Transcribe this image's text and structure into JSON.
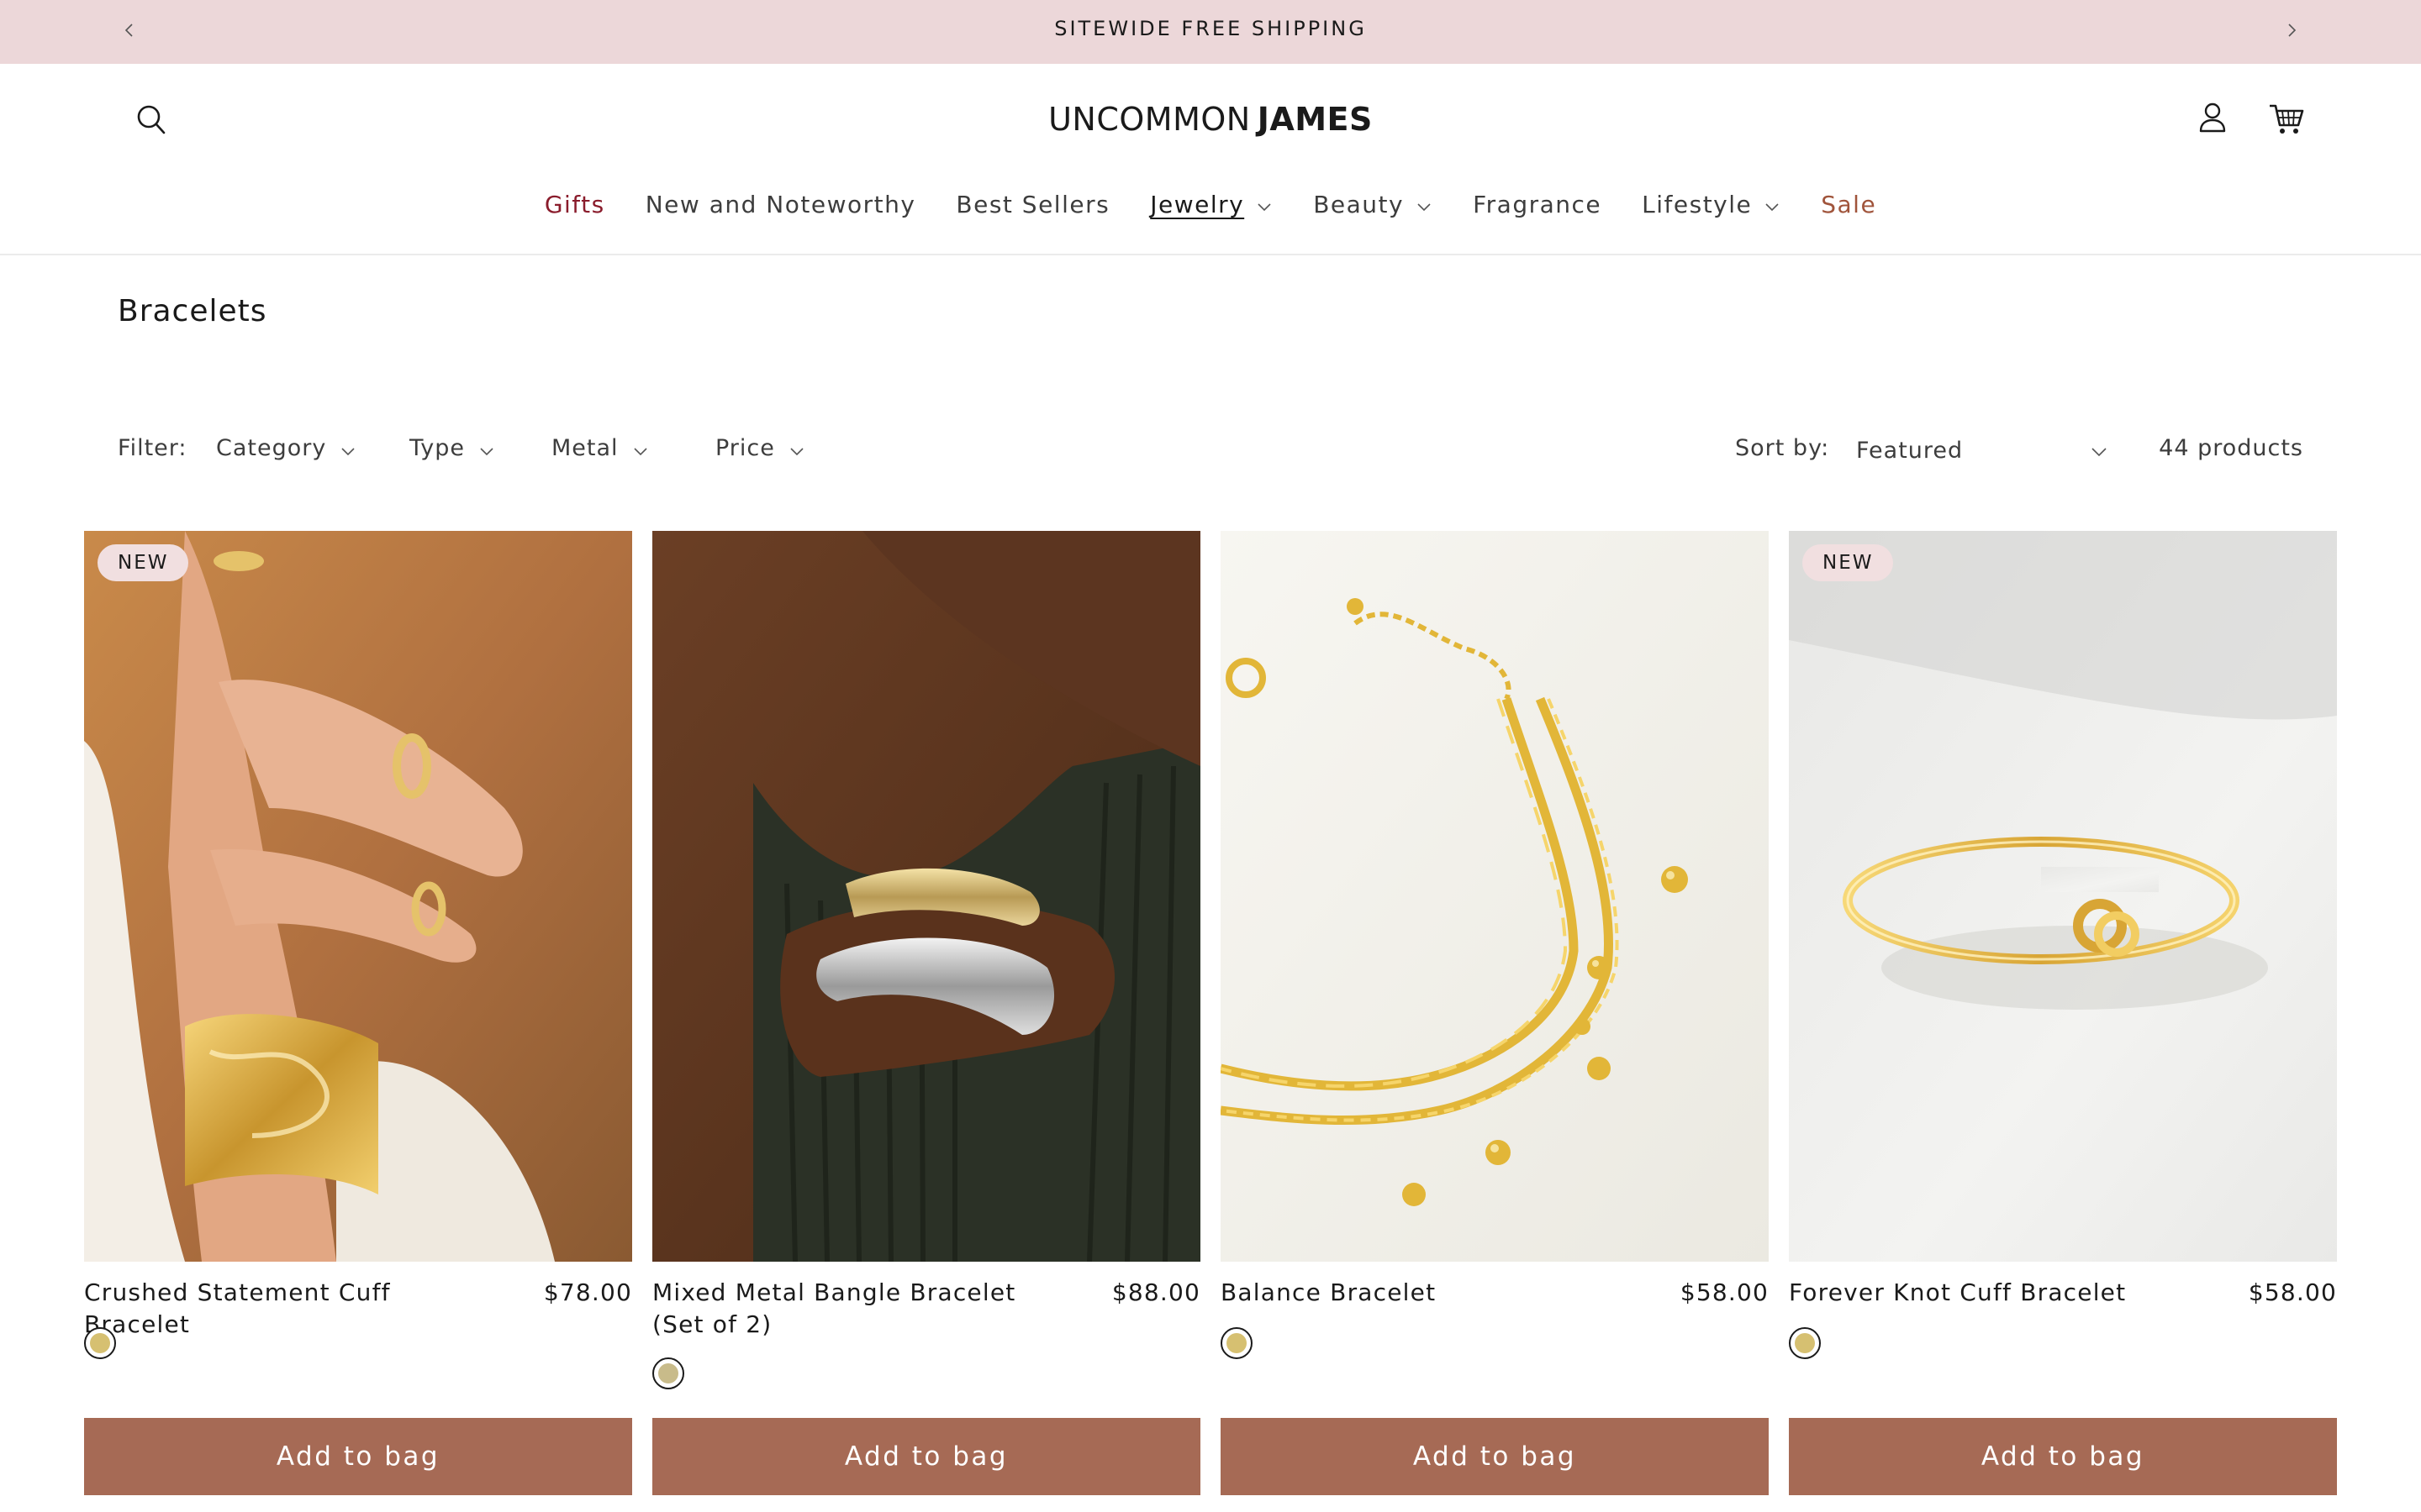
{
  "announcement": {
    "text": "SITEWIDE FREE SHIPPING",
    "prev_icon": "chevron-left-icon",
    "next_icon": "chevron-right-icon"
  },
  "header": {
    "logo_part1": "UNCOMMON",
    "logo_part2": "JAMES",
    "search_icon": "search-icon",
    "account_icon": "user-icon",
    "cart_icon": "cart-icon"
  },
  "nav": {
    "items": [
      {
        "label": "Gifts",
        "has_dropdown": false
      },
      {
        "label": "New and Noteworthy",
        "has_dropdown": false
      },
      {
        "label": "Best Sellers",
        "has_dropdown": false
      },
      {
        "label": "Jewelry",
        "has_dropdown": true,
        "active": true
      },
      {
        "label": "Beauty",
        "has_dropdown": true
      },
      {
        "label": "Fragrance",
        "has_dropdown": false
      },
      {
        "label": "Lifestyle",
        "has_dropdown": true
      },
      {
        "label": "Sale",
        "has_dropdown": false
      }
    ]
  },
  "page": {
    "title": "Bracelets"
  },
  "filters": {
    "label": "Filter:",
    "items": [
      "Category",
      "Type",
      "Metal",
      "Price"
    ],
    "sort_label": "Sort by:",
    "sort_value": "Featured",
    "count": "44 products"
  },
  "products": [
    {
      "name": "Crushed Statement Cuff Bracelet",
      "price": "$78.00",
      "badge": "NEW",
      "swatch_color": "#d6c071",
      "button": "Add to bag"
    },
    {
      "name": "Mixed Metal Bangle Bracelet (Set of 2)",
      "price": "$88.00",
      "badge": "",
      "swatch_color": "#c8bb8a",
      "button": "Add to bag"
    },
    {
      "name": "Balance Bracelet",
      "price": "$58.00",
      "badge": "",
      "swatch_color": "#d6c071",
      "button": "Add to bag"
    },
    {
      "name": "Forever Knot Cuff Bracelet",
      "price": "$58.00",
      "badge": "NEW",
      "swatch_color": "#d6c071",
      "button": "Add to bag"
    }
  ],
  "colors": {
    "announcement_bg": "#ecd7d9",
    "button_bg": "#a66a55",
    "gifts_text": "#8a1c2c",
    "sale_text": "#a0543b",
    "badge_bg": "#f1dfe0"
  }
}
